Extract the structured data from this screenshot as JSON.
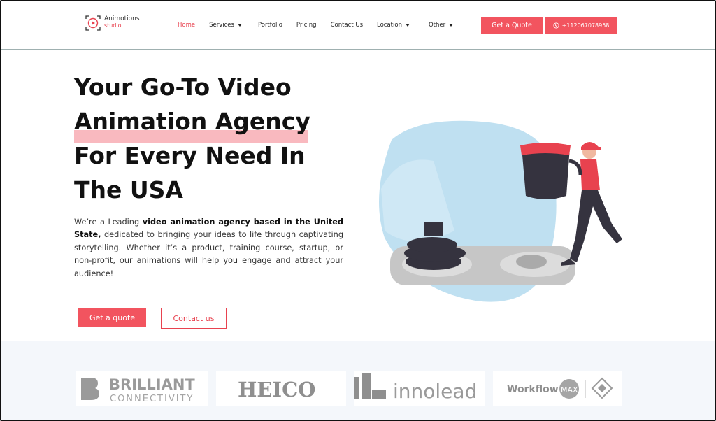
{
  "header": {
    "logo": {
      "line1": "Animotions",
      "line2": "studio"
    },
    "nav": [
      {
        "label": "Home",
        "active": true,
        "dropdown": false
      },
      {
        "label": "Services",
        "active": false,
        "dropdown": true
      },
      {
        "label": "Portfolio",
        "active": false,
        "dropdown": false
      },
      {
        "label": "Pricing",
        "active": false,
        "dropdown": false
      },
      {
        "label": "Contact Us",
        "active": false,
        "dropdown": false
      },
      {
        "label": "Location",
        "active": false,
        "dropdown": true
      },
      {
        "label": "Other",
        "active": false,
        "dropdown": true
      }
    ],
    "quote_button": "Get a Quote",
    "phone_button": "+112067078958"
  },
  "hero": {
    "headline": [
      "Your Go-To Video",
      "Animation Agency",
      "For Every Need In",
      "The USA"
    ],
    "intro_prefix": "We’re a Leading ",
    "intro_bold": "video animation agency based in the United State,",
    "intro_suffix": " dedicated to bringing your ideas to life through captivating storytelling. Whether it’s a product, training course, startup, or non-profit, our animations will help you engage and attract your audience!",
    "cta_primary": "Get a quote",
    "cta_secondary": "Contact us"
  },
  "clients": [
    {
      "name": "BRILLIANT",
      "sub": "CONNECTIVITY"
    },
    {
      "name": "HEICO",
      "sub": ""
    },
    {
      "name": "innolead",
      "sub": ""
    },
    {
      "name": "Workflow",
      "sub": "MAX"
    }
  ],
  "colors": {
    "accent": "#f2545f",
    "highlight": "#f9b9bf",
    "illustration_blue": "#bfe0f1",
    "illustration_dark": "#35333f"
  }
}
